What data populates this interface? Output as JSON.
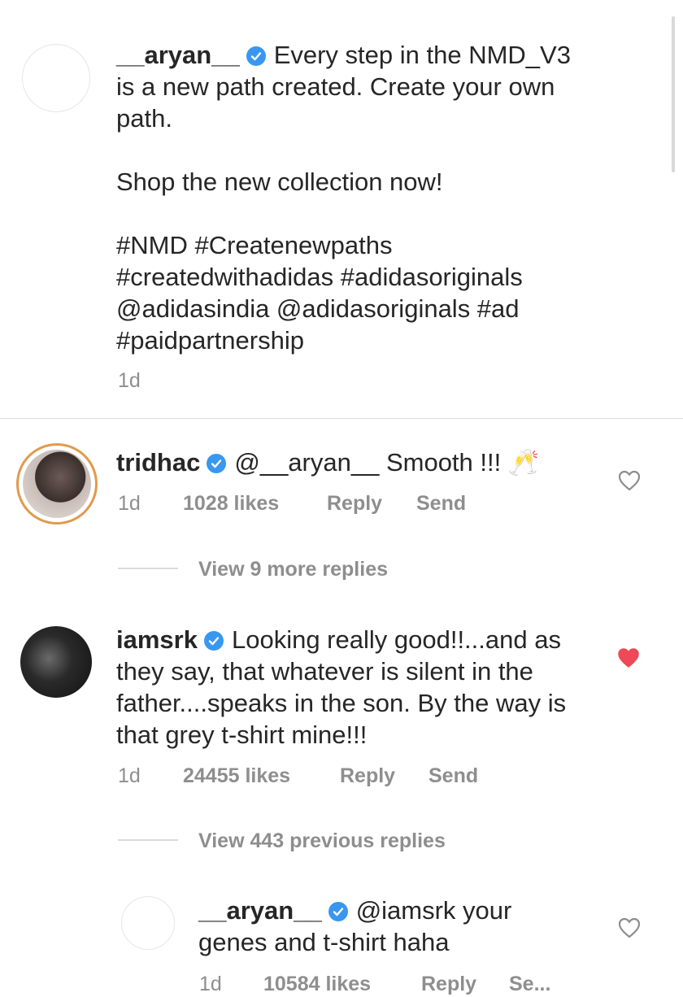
{
  "caption": {
    "username": "__aryan__",
    "line1": "Every step in the NMD_V3",
    "line2": "is a new path created. Create your own",
    "line3": "path.",
    "line4": "Shop the new collection now!",
    "line5": "#NMD #Createnewpaths",
    "line6": "#createdwithadidas #adidasoriginals",
    "line7": "@adidasindia @adidasoriginals #ad",
    "line8": "#paidpartnership",
    "time": "1d"
  },
  "comments": [
    {
      "username": "tridhac",
      "line1": "@__aryan__  Smooth !!! 🥂",
      "time": "1d",
      "likes": "1028 likes",
      "reply": "Reply",
      "send": "Send",
      "liked": false,
      "view_more": "View 9 more replies"
    },
    {
      "username": "iamsrk",
      "line1": "Looking really good!!...and as",
      "line2": "they say, that whatever is silent in the",
      "line3": "father....speaks in the son. By the way is",
      "line4": "that grey t-shirt mine!!!",
      "time": "1d",
      "likes": "24455 likes",
      "reply": "Reply",
      "send": "Send",
      "liked": true,
      "view_more": "View 443 previous replies"
    }
  ],
  "reply": {
    "username": "__aryan__",
    "mention": "@iamsrk",
    "line1": " your",
    "line2": "genes and t-shirt haha",
    "time": "1d",
    "likes": "10584 likes",
    "reply": "Reply",
    "send": "Se...",
    "liked": false
  },
  "colors": {
    "verified": "#3897f0",
    "heart_liked": "#ed4956",
    "meta_text": "#8e8e8e"
  }
}
